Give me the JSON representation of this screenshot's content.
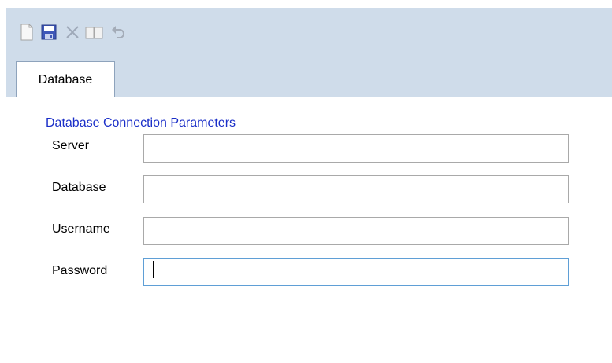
{
  "toolbar": {
    "buttons": [
      {
        "name": "new-icon"
      },
      {
        "name": "save-icon"
      },
      {
        "name": "delete-icon"
      },
      {
        "name": "copy-icon"
      },
      {
        "name": "undo-icon"
      }
    ]
  },
  "tabs": [
    {
      "label": "Database",
      "active": true
    }
  ],
  "group": {
    "legend": "Database Connection Parameters",
    "fields": [
      {
        "label": "Server",
        "value": ""
      },
      {
        "label": "Database",
        "value": ""
      },
      {
        "label": "Username",
        "value": ""
      },
      {
        "label": "Password",
        "value": ""
      }
    ]
  },
  "colors": {
    "toolbar_bg": "#cfdcea",
    "legend_text": "#1a2ec8",
    "focus_border": "#5f9fd6"
  }
}
